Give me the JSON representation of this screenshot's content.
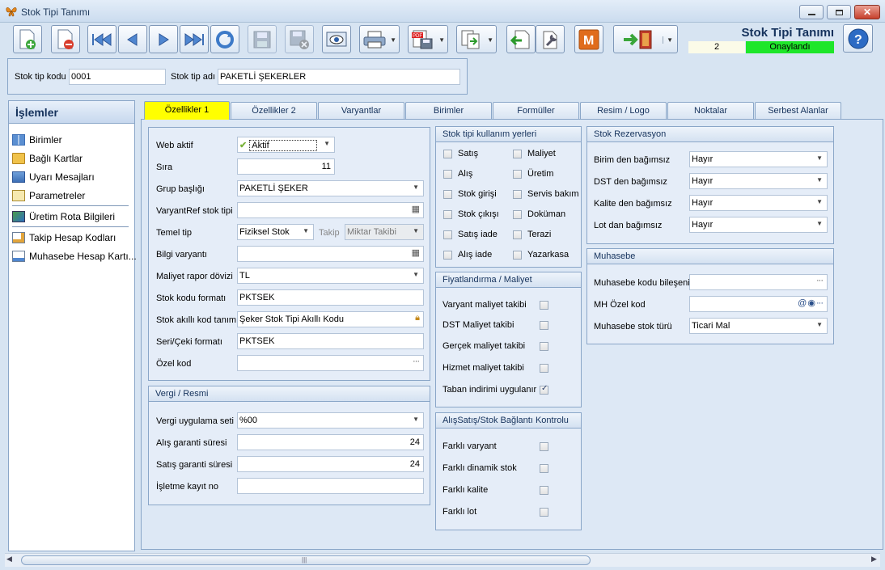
{
  "window": {
    "title": "Stok Tipi Tanımı"
  },
  "toolbar": {
    "icons": [
      "new-doc-icon",
      "delete-doc-icon",
      "first-record-icon",
      "previous-record-icon",
      "next-record-icon",
      "last-record-icon",
      "refresh-icon",
      "save-icon",
      "save-close-icon",
      "preview-icon",
      "print-icon",
      "pdf-export-icon",
      "copy-icon",
      "import-icon",
      "tools-icon",
      "m-module-icon",
      "exit-icon"
    ]
  },
  "header": {
    "title": "Stok Tipi Tanımı",
    "number": "2",
    "status": "Onaylandı"
  },
  "top": {
    "code_label": "Stok tip kodu",
    "code_value": "0001",
    "name_label": "Stok tip adı",
    "name_value": "PAKETLİ ŞEKERLER"
  },
  "sidebar": {
    "title": "İşlemler",
    "items": [
      "Birimler",
      "Bağlı Kartlar",
      "Uyarı Mesajları",
      "Parametreler",
      "Üretim Rota Bilgileri",
      "Takip Hesap Kodları",
      "Muhasebe Hesap Kartı..."
    ]
  },
  "tabs": [
    "Özellikler 1",
    "Özellikler 2",
    "Varyantlar",
    "Birimler",
    "Formüller",
    "Resim / Logo",
    "Noktalar",
    "Serbest Alanlar"
  ],
  "general": {
    "web_aktif_label": "Web aktif",
    "web_aktif_value": "Aktif",
    "sira_label": "Sıra",
    "sira_value": "11",
    "grup_label": "Grup başlığı",
    "grup_value": "PAKETLİ ŞEKER",
    "varyantref_label": "VaryantRef stok tipi",
    "varyantref_value": "",
    "temel_tip_label": "Temel tip",
    "temel_tip_value": "Fiziksel Stok",
    "takip_label": "Takip",
    "takip_value": "Miktar Takibi",
    "bilgi_label": "Bilgi varyantı",
    "bilgi_value": "",
    "maliyet_doviz_label": "Maliyet rapor dövizi",
    "maliyet_doviz_value": "TL",
    "stok_kodu_formati_label": "Stok kodu formatı",
    "stok_kodu_formati_value": "PKTSEK",
    "akilli_kod_label": "Stok akıllı kod tanımı",
    "akilli_kod_value": "Şeker Stok Tipi Akıllı Kodu",
    "seri_cek_label": "Seri/Çeki formatı",
    "seri_cek_value": "PKTSEK",
    "ozel_kod_label": "Özel kod",
    "ozel_kod_value": ""
  },
  "vergi": {
    "title": "Vergi / Resmi",
    "vergi_seti_label": "Vergi uygulama seti",
    "vergi_seti_value": "%00",
    "alis_garanti_label": "Alış garanti süresi",
    "alis_garanti_value": "24",
    "satis_garanti_label": "Satış garanti süresi",
    "satis_garanti_value": "24",
    "isletme_label": "İşletme kayıt no",
    "isletme_value": ""
  },
  "kullanim": {
    "title": "Stok tipi kullanım yerleri",
    "items": [
      {
        "label": "Satış",
        "checked": false
      },
      {
        "label": "Maliyet",
        "checked": false
      },
      {
        "label": "Alış",
        "checked": false
      },
      {
        "label": "Üretim",
        "checked": false
      },
      {
        "label": "Stok girişi",
        "checked": false
      },
      {
        "label": "Servis bakım",
        "checked": false
      },
      {
        "label": "Stok çıkışı",
        "checked": false
      },
      {
        "label": "Doküman",
        "checked": false
      },
      {
        "label": "Satış iade",
        "checked": false
      },
      {
        "label": "Terazi",
        "checked": false
      },
      {
        "label": "Alış iade",
        "checked": false
      },
      {
        "label": "Yazarkasa",
        "checked": false
      }
    ]
  },
  "fiyat": {
    "title": "Fiyatlandırma / Maliyet",
    "items": [
      {
        "label": "Varyant maliyet takibi",
        "checked": false
      },
      {
        "label": "DST Maliyet takibi",
        "checked": false
      },
      {
        "label": "Gerçek maliyet takibi",
        "checked": false
      },
      {
        "label": "Hizmet maliyet takibi",
        "checked": false
      },
      {
        "label": "Taban indirimi uygulanır",
        "checked": true
      }
    ]
  },
  "baglanti": {
    "title": "AlışSatış/Stok Bağlantı Kontrolu",
    "items": [
      {
        "label": "Farklı varyant",
        "checked": false
      },
      {
        "label": "Farklı dinamik stok",
        "checked": false
      },
      {
        "label": "Farklı kalite",
        "checked": false
      },
      {
        "label": "Farklı lot",
        "checked": false
      }
    ]
  },
  "rezervasyon": {
    "title": "Stok Rezervasyon",
    "items": [
      {
        "label": "Birim den bağımsız",
        "value": "Hayır"
      },
      {
        "label": "DST den bağımsız",
        "value": "Hayır"
      },
      {
        "label": "Kalite den bağımsız",
        "value": "Hayır"
      },
      {
        "label": "Lot dan bağımsız",
        "value": "Hayır"
      }
    ]
  },
  "muhasebe": {
    "title": "Muhasebe",
    "kod_label": "Muhasebe kodu bileşeni",
    "kod_value": "",
    "mh_label": "MH Özel kod",
    "mh_value": "",
    "tur_label": "Muhasebe stok türü",
    "tur_value": "Ticari Mal"
  },
  "colors": {
    "status": "#1ee62a",
    "active_tab": "#ffff00",
    "accent": "#15325c"
  }
}
